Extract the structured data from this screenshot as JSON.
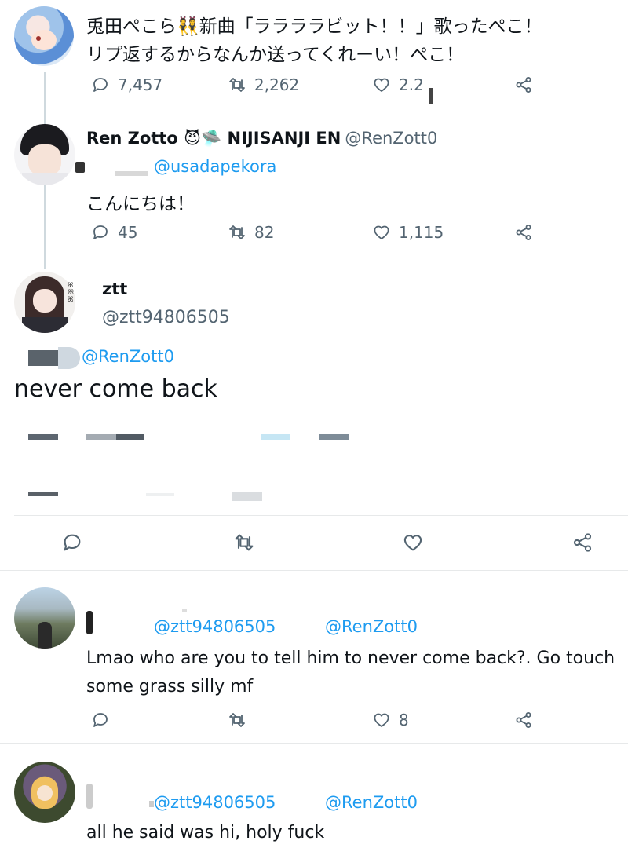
{
  "tweet1": {
    "name": "兎田ぺこら👯新曲「ララララビット！！」歌ったぺこ！",
    "text": "リプ返するからなんか送ってくれーい！ぺこ！",
    "replies": "7,457",
    "retweets": "2,262",
    "likes": "2.2"
  },
  "tweet2": {
    "name": "Ren Zotto 😈🛸 NIJISANJI EN",
    "handle": "@RenZott0",
    "mention": "@usadapekora",
    "text": "こんにちは！",
    "replies": "45",
    "retweets": "82",
    "likes": "1,115"
  },
  "tweet3": {
    "name": "ztt",
    "handle": "@ztt94806505",
    "mention": "@RenZott0",
    "text": "never come back"
  },
  "reply1": {
    "mention1": "@ztt94806505",
    "mention2": "@RenZott0",
    "text_line1": "Lmao who are you to tell him to never come back?. Go touch",
    "text_line2": "some grass silly mf",
    "likes": "8"
  },
  "reply2": {
    "mention1": "@ztt94806505",
    "mention2": "@RenZott0",
    "text": "all he said was hi, holy fuck"
  },
  "colors": {
    "accent": "#1d9bf0",
    "text": "#0f1419",
    "muted": "#536471",
    "divider": "#e7e9ea"
  },
  "icons": [
    "reply-icon",
    "retweet-icon",
    "like-icon",
    "share-icon"
  ]
}
